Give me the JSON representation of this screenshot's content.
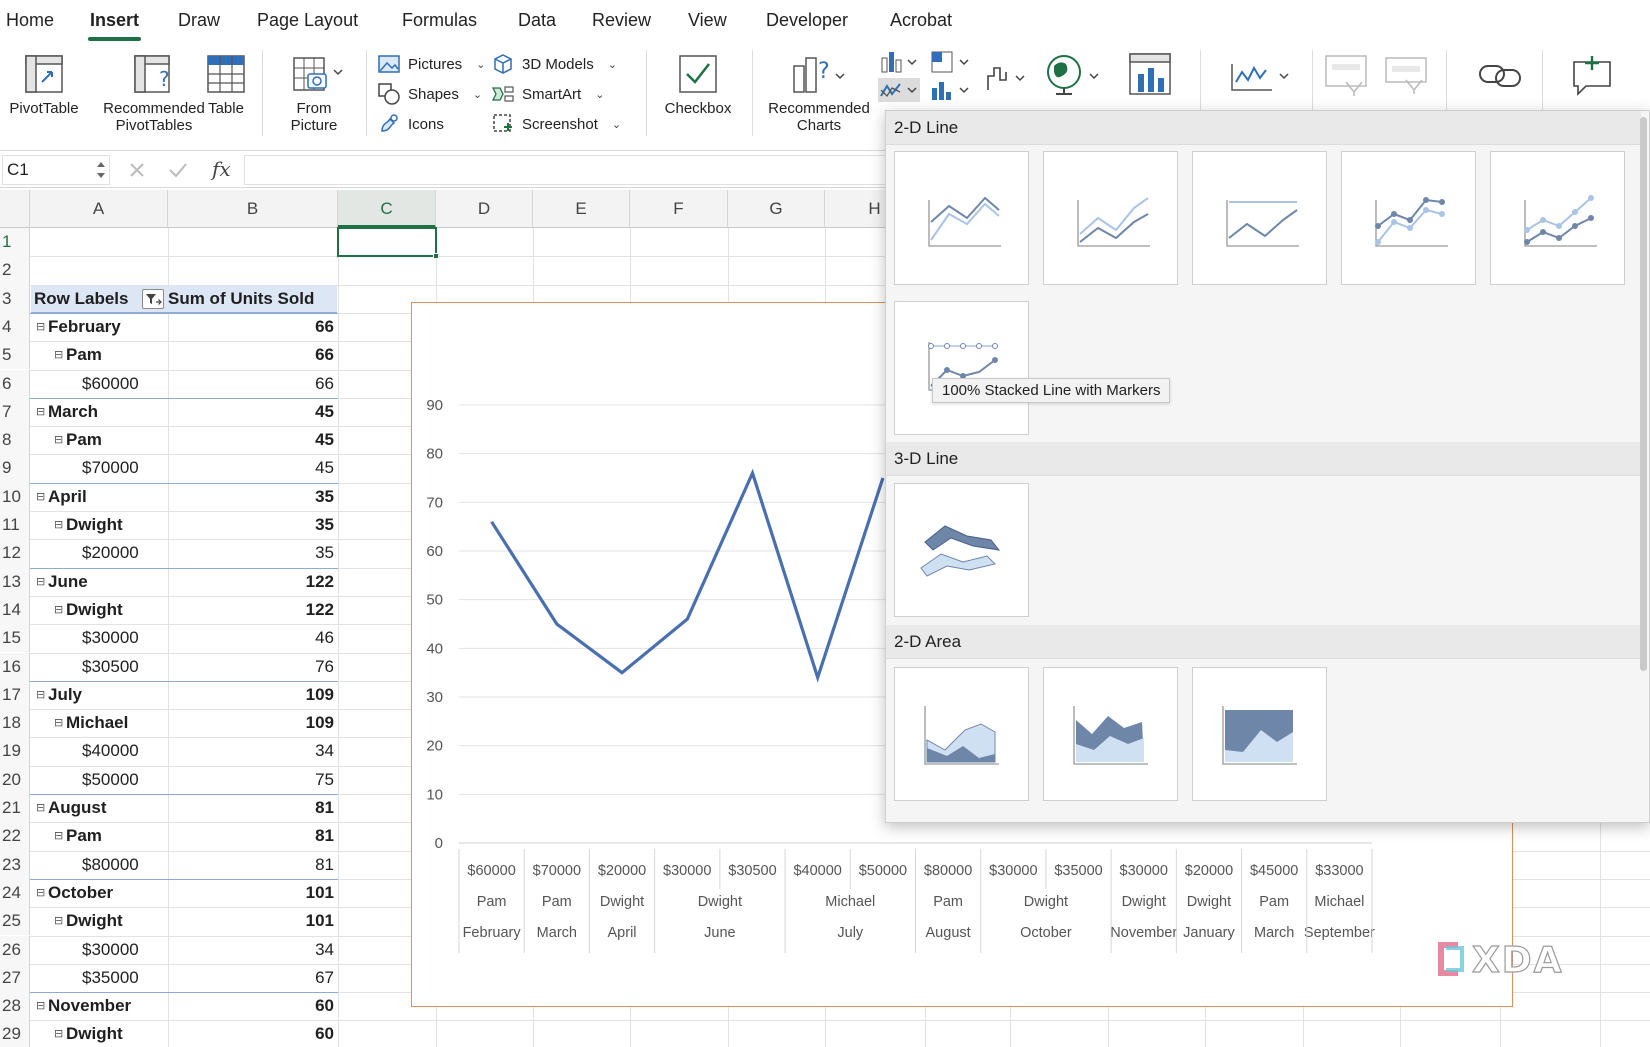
{
  "menu": {
    "tabs": [
      "Home",
      "Insert",
      "Draw",
      "Page Layout",
      "Formulas",
      "Data",
      "Review",
      "View",
      "Developer",
      "Acrobat"
    ],
    "active": "Insert"
  },
  "ribbon": {
    "pivot_table": "PivotTable",
    "recommended_pivot_1": "Recommended",
    "recommended_pivot_2": "PivotTables",
    "table": "Table",
    "from_picture_1": "From",
    "from_picture_2": "Picture",
    "pictures": "Pictures",
    "shapes": "Shapes",
    "icons": "Icons",
    "models_3d": "3D Models",
    "smartart": "SmartArt",
    "screenshot": "Screenshot",
    "checkbox": "Checkbox",
    "recommended_charts_1": "Recommended",
    "recommended_charts_2": "Charts"
  },
  "formula_bar": {
    "name_box": "C1",
    "fx": "fx",
    "content": ""
  },
  "columns": [
    "A",
    "B",
    "C",
    "D",
    "E",
    "F",
    "G",
    "H"
  ],
  "selected_column": "C",
  "rows": [
    {
      "n": "1",
      "a": "",
      "b": "",
      "level": 0,
      "bold": false
    },
    {
      "n": "2",
      "a": "",
      "b": "",
      "level": 0,
      "bold": false
    },
    {
      "n": "3",
      "a": "Row Labels",
      "b": "Sum of Units Sold",
      "level": 0,
      "bold": true,
      "header": true
    },
    {
      "n": "4",
      "a": "February",
      "b": "66",
      "level": 1,
      "bold": true
    },
    {
      "n": "5",
      "a": "Pam",
      "b": "66",
      "level": 2,
      "bold": true
    },
    {
      "n": "6",
      "a": "$60000",
      "b": "66",
      "level": 3,
      "bold": false
    },
    {
      "n": "7",
      "a": "March",
      "b": "45",
      "level": 1,
      "bold": true
    },
    {
      "n": "8",
      "a": "Pam",
      "b": "45",
      "level": 2,
      "bold": true
    },
    {
      "n": "9",
      "a": "$70000",
      "b": "45",
      "level": 3,
      "bold": false
    },
    {
      "n": "10",
      "a": "April",
      "b": "35",
      "level": 1,
      "bold": true
    },
    {
      "n": "11",
      "a": "Dwight",
      "b": "35",
      "level": 2,
      "bold": true
    },
    {
      "n": "12",
      "a": "$20000",
      "b": "35",
      "level": 3,
      "bold": false
    },
    {
      "n": "13",
      "a": "June",
      "b": "122",
      "level": 1,
      "bold": true
    },
    {
      "n": "14",
      "a": "Dwight",
      "b": "122",
      "level": 2,
      "bold": true
    },
    {
      "n": "15",
      "a": "$30000",
      "b": "46",
      "level": 3,
      "bold": false
    },
    {
      "n": "16",
      "a": "$30500",
      "b": "76",
      "level": 3,
      "bold": false
    },
    {
      "n": "17",
      "a": "July",
      "b": "109",
      "level": 1,
      "bold": true
    },
    {
      "n": "18",
      "a": "Michael",
      "b": "109",
      "level": 2,
      "bold": true
    },
    {
      "n": "19",
      "a": "$40000",
      "b": "34",
      "level": 3,
      "bold": false
    },
    {
      "n": "20",
      "a": "$50000",
      "b": "75",
      "level": 3,
      "bold": false
    },
    {
      "n": "21",
      "a": "August",
      "b": "81",
      "level": 1,
      "bold": true
    },
    {
      "n": "22",
      "a": "Pam",
      "b": "81",
      "level": 2,
      "bold": true
    },
    {
      "n": "23",
      "a": "$80000",
      "b": "81",
      "level": 3,
      "bold": false
    },
    {
      "n": "24",
      "a": "October",
      "b": "101",
      "level": 1,
      "bold": true
    },
    {
      "n": "25",
      "a": "Dwight",
      "b": "101",
      "level": 2,
      "bold": true
    },
    {
      "n": "26",
      "a": "$30000",
      "b": "34",
      "level": 3,
      "bold": false
    },
    {
      "n": "27",
      "a": "$35000",
      "b": "67",
      "level": 3,
      "bold": false
    },
    {
      "n": "28",
      "a": "November",
      "b": "60",
      "level": 1,
      "bold": true
    },
    {
      "n": "29",
      "a": "Dwight",
      "b": "60",
      "level": 2,
      "bold": true
    }
  ],
  "chart_data": {
    "type": "line",
    "y_ticks": [
      "0",
      "10",
      "20",
      "30",
      "40",
      "50",
      "60",
      "70",
      "80",
      "90"
    ],
    "ylim": [
      0,
      90
    ],
    "grid": true,
    "line_color": "#4a6fb0",
    "visible_points": 7,
    "categories": [
      {
        "amount": "$60000",
        "person": "Pam",
        "month": "February",
        "value": 66
      },
      {
        "amount": "$70000",
        "person": "Pam",
        "month": "March",
        "value": 45
      },
      {
        "amount": "$20000",
        "person": "Dwight",
        "month": "April",
        "value": 35
      },
      {
        "amount": "$30000",
        "person": "Dwight",
        "month": "June",
        "value": 46
      },
      {
        "amount": "$30500",
        "person": "",
        "month": "",
        "value": 76
      },
      {
        "amount": "$40000",
        "person": "Michael",
        "month": "July",
        "value": 34
      },
      {
        "amount": "$50000",
        "person": "",
        "month": "",
        "value": 75
      },
      {
        "amount": "$80000",
        "person": "Pam",
        "month": "August",
        "value": null
      },
      {
        "amount": "$30000",
        "person": "Dwight",
        "month": "October",
        "value": null
      },
      {
        "amount": "$35000",
        "person": "",
        "month": "",
        "value": null
      },
      {
        "amount": "$30000",
        "person": "Dwight",
        "month": "November",
        "value": null
      },
      {
        "amount": "$20000",
        "person": "Dwight",
        "month": "January",
        "value": null
      },
      {
        "amount": "$45000",
        "person": "Pam",
        "month": "March",
        "value": null
      },
      {
        "amount": "$33000",
        "person": "Michael",
        "month": "September",
        "value": null
      }
    ],
    "person_groups": [
      {
        "label": "Pam",
        "span": 1
      },
      {
        "label": "Pam",
        "span": 1
      },
      {
        "label": "Dwight",
        "span": 1
      },
      {
        "label": "Dwight",
        "span": 2
      },
      {
        "label": "Michael",
        "span": 2
      },
      {
        "label": "Pam",
        "span": 1
      },
      {
        "label": "Dwight",
        "span": 2
      },
      {
        "label": "Dwight",
        "span": 1
      },
      {
        "label": "Dwight",
        "span": 1
      },
      {
        "label": "Pam",
        "span": 1
      },
      {
        "label": "Michael",
        "span": 1
      }
    ],
    "month_groups": [
      {
        "label": "February",
        "span": 1
      },
      {
        "label": "March",
        "span": 1
      },
      {
        "label": "April",
        "span": 1
      },
      {
        "label": "June",
        "span": 2
      },
      {
        "label": "July",
        "span": 2
      },
      {
        "label": "August",
        "span": 1
      },
      {
        "label": "October",
        "span": 2
      },
      {
        "label": "November",
        "span": 1
      },
      {
        "label": "January",
        "span": 1
      },
      {
        "label": "March",
        "span": 1
      },
      {
        "label": "September",
        "span": 1
      }
    ]
  },
  "dropdown": {
    "section_2d_line": "2-D Line",
    "section_3d_line": "3-D Line",
    "section_2d_area": "2-D Area",
    "tooltip": "100% Stacked Line with Markers"
  },
  "watermark": "XDA"
}
